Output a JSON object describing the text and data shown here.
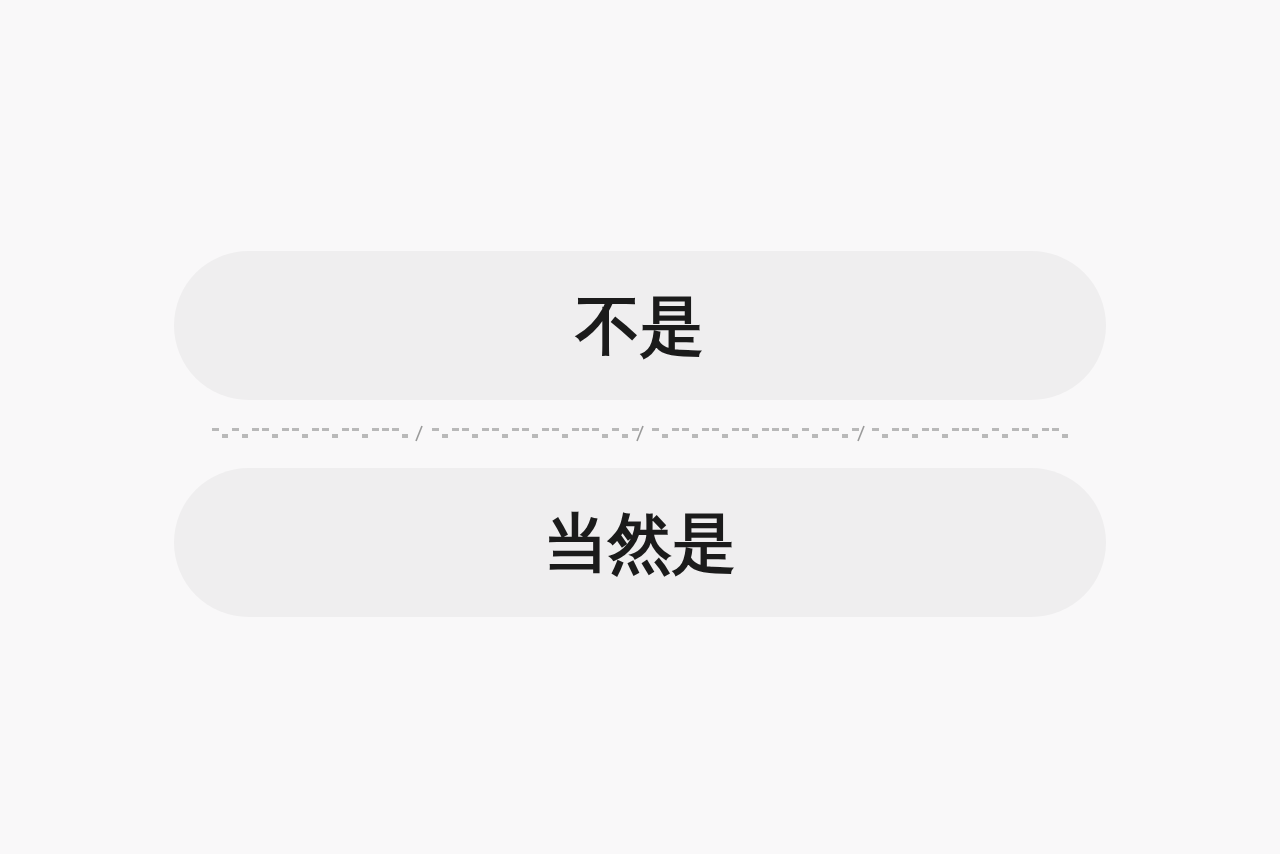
{
  "options": [
    {
      "label": "不是"
    },
    {
      "label": "当然是"
    }
  ]
}
